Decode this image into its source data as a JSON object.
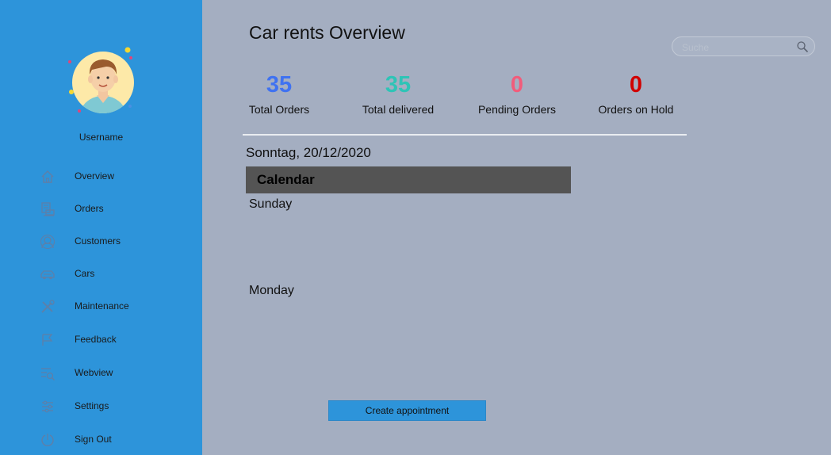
{
  "sidebar": {
    "username": "Username",
    "items": [
      {
        "label": "Overview",
        "icon": "home-icon"
      },
      {
        "label": "Orders",
        "icon": "orders-icon"
      },
      {
        "label": "Customers",
        "icon": "customers-icon"
      },
      {
        "label": "Cars",
        "icon": "car-icon"
      },
      {
        "label": "Maintenance",
        "icon": "tools-icon"
      },
      {
        "label": "Feedback",
        "icon": "feedback-icon"
      },
      {
        "label": "Webview",
        "icon": "webview-icon"
      },
      {
        "label": "Settings",
        "icon": "settings-icon"
      },
      {
        "label": "Sign Out",
        "icon": "signout-icon"
      }
    ]
  },
  "main": {
    "title": "Car rents Overview",
    "search_placeholder": "Suche",
    "stats": [
      {
        "value": "35",
        "label": "Total Orders",
        "color": "#3f72f1"
      },
      {
        "value": "35",
        "label": "Total delivered",
        "color": "#2ec4b6"
      },
      {
        "value": "0",
        "label": "Pending Orders",
        "color": "#f25c7b"
      },
      {
        "value": "0",
        "label": "Orders on Hold",
        "color": "#d10000"
      }
    ],
    "date": "Sonntag, 20/12/2020",
    "calendar_title": "Calendar",
    "days": [
      "Sunday",
      "Monday"
    ],
    "create_button": "Create appointment"
  },
  "colors": {
    "sidebar_bg": "#2d94da",
    "main_bg": "#a4aec1",
    "calendar_header_bg": "#545454"
  }
}
